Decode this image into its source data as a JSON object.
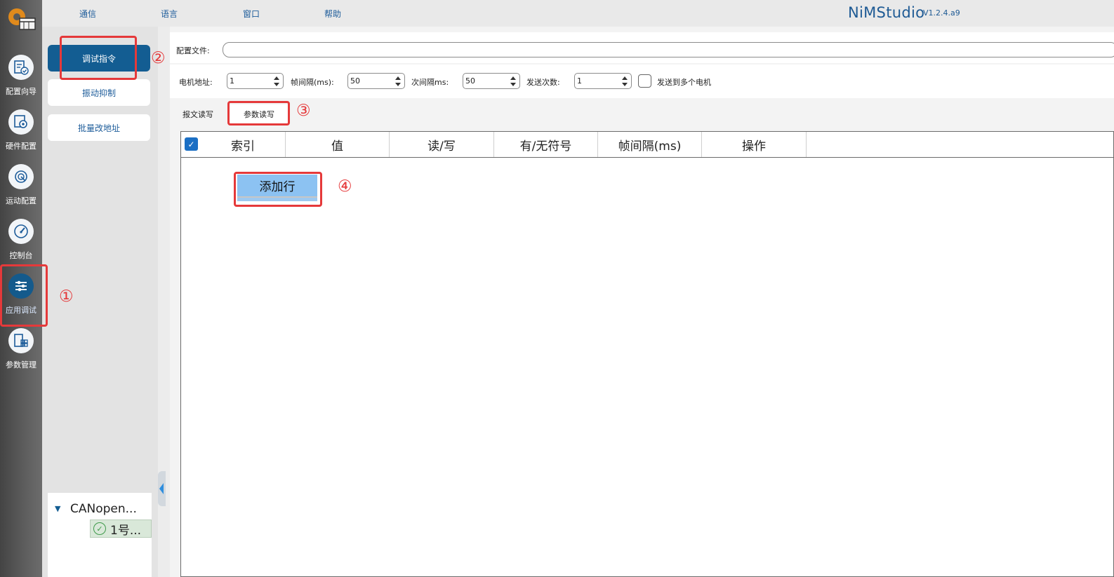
{
  "app": {
    "title": "NiMStudio",
    "version": "V1.2.4.a9"
  },
  "menu": [
    "通信",
    "语言",
    "窗口",
    "帮助"
  ],
  "rail": [
    {
      "label": "配置向导",
      "icon": "config-wizard-icon"
    },
    {
      "label": "硬件配置",
      "icon": "hardware-config-icon"
    },
    {
      "label": "运动配置",
      "icon": "motion-config-icon"
    },
    {
      "label": "控制台",
      "icon": "console-gauge-icon"
    },
    {
      "label": "应用调试",
      "icon": "sliders-icon",
      "active": true
    },
    {
      "label": "参数管理",
      "icon": "param-manage-icon"
    }
  ],
  "subnav": [
    {
      "label": "调试指令",
      "active": true
    },
    {
      "label": "振动抑制"
    },
    {
      "label": "批量改地址"
    }
  ],
  "tree": {
    "root": "CANopen...",
    "child": "1号..."
  },
  "config": {
    "label": "配置文件:",
    "value": ""
  },
  "params": {
    "motor_addr": {
      "label": "电机地址:",
      "value": "1"
    },
    "frame_interval": {
      "label": "帧间隔(ms):",
      "value": "50"
    },
    "sub_interval": {
      "label": "次间隔ms:",
      "value": "50"
    },
    "send_count": {
      "label": "发送次数:",
      "value": "1"
    },
    "multi_motor": {
      "label": "发送到多个电机",
      "checked": false
    }
  },
  "tabs": [
    {
      "label": "报文读写"
    },
    {
      "label": "参数读写",
      "active": true
    }
  ],
  "table": {
    "columns": [
      "索引",
      "值",
      "读/写",
      "有/无符号",
      "帧间隔(ms)",
      "操作"
    ],
    "add_row_label": "添加行"
  },
  "annotations": [
    "①",
    "②",
    "③",
    "④"
  ],
  "colors": {
    "accent": "#135d92",
    "annotation": "#e5393a",
    "title": "#1e5a94"
  }
}
